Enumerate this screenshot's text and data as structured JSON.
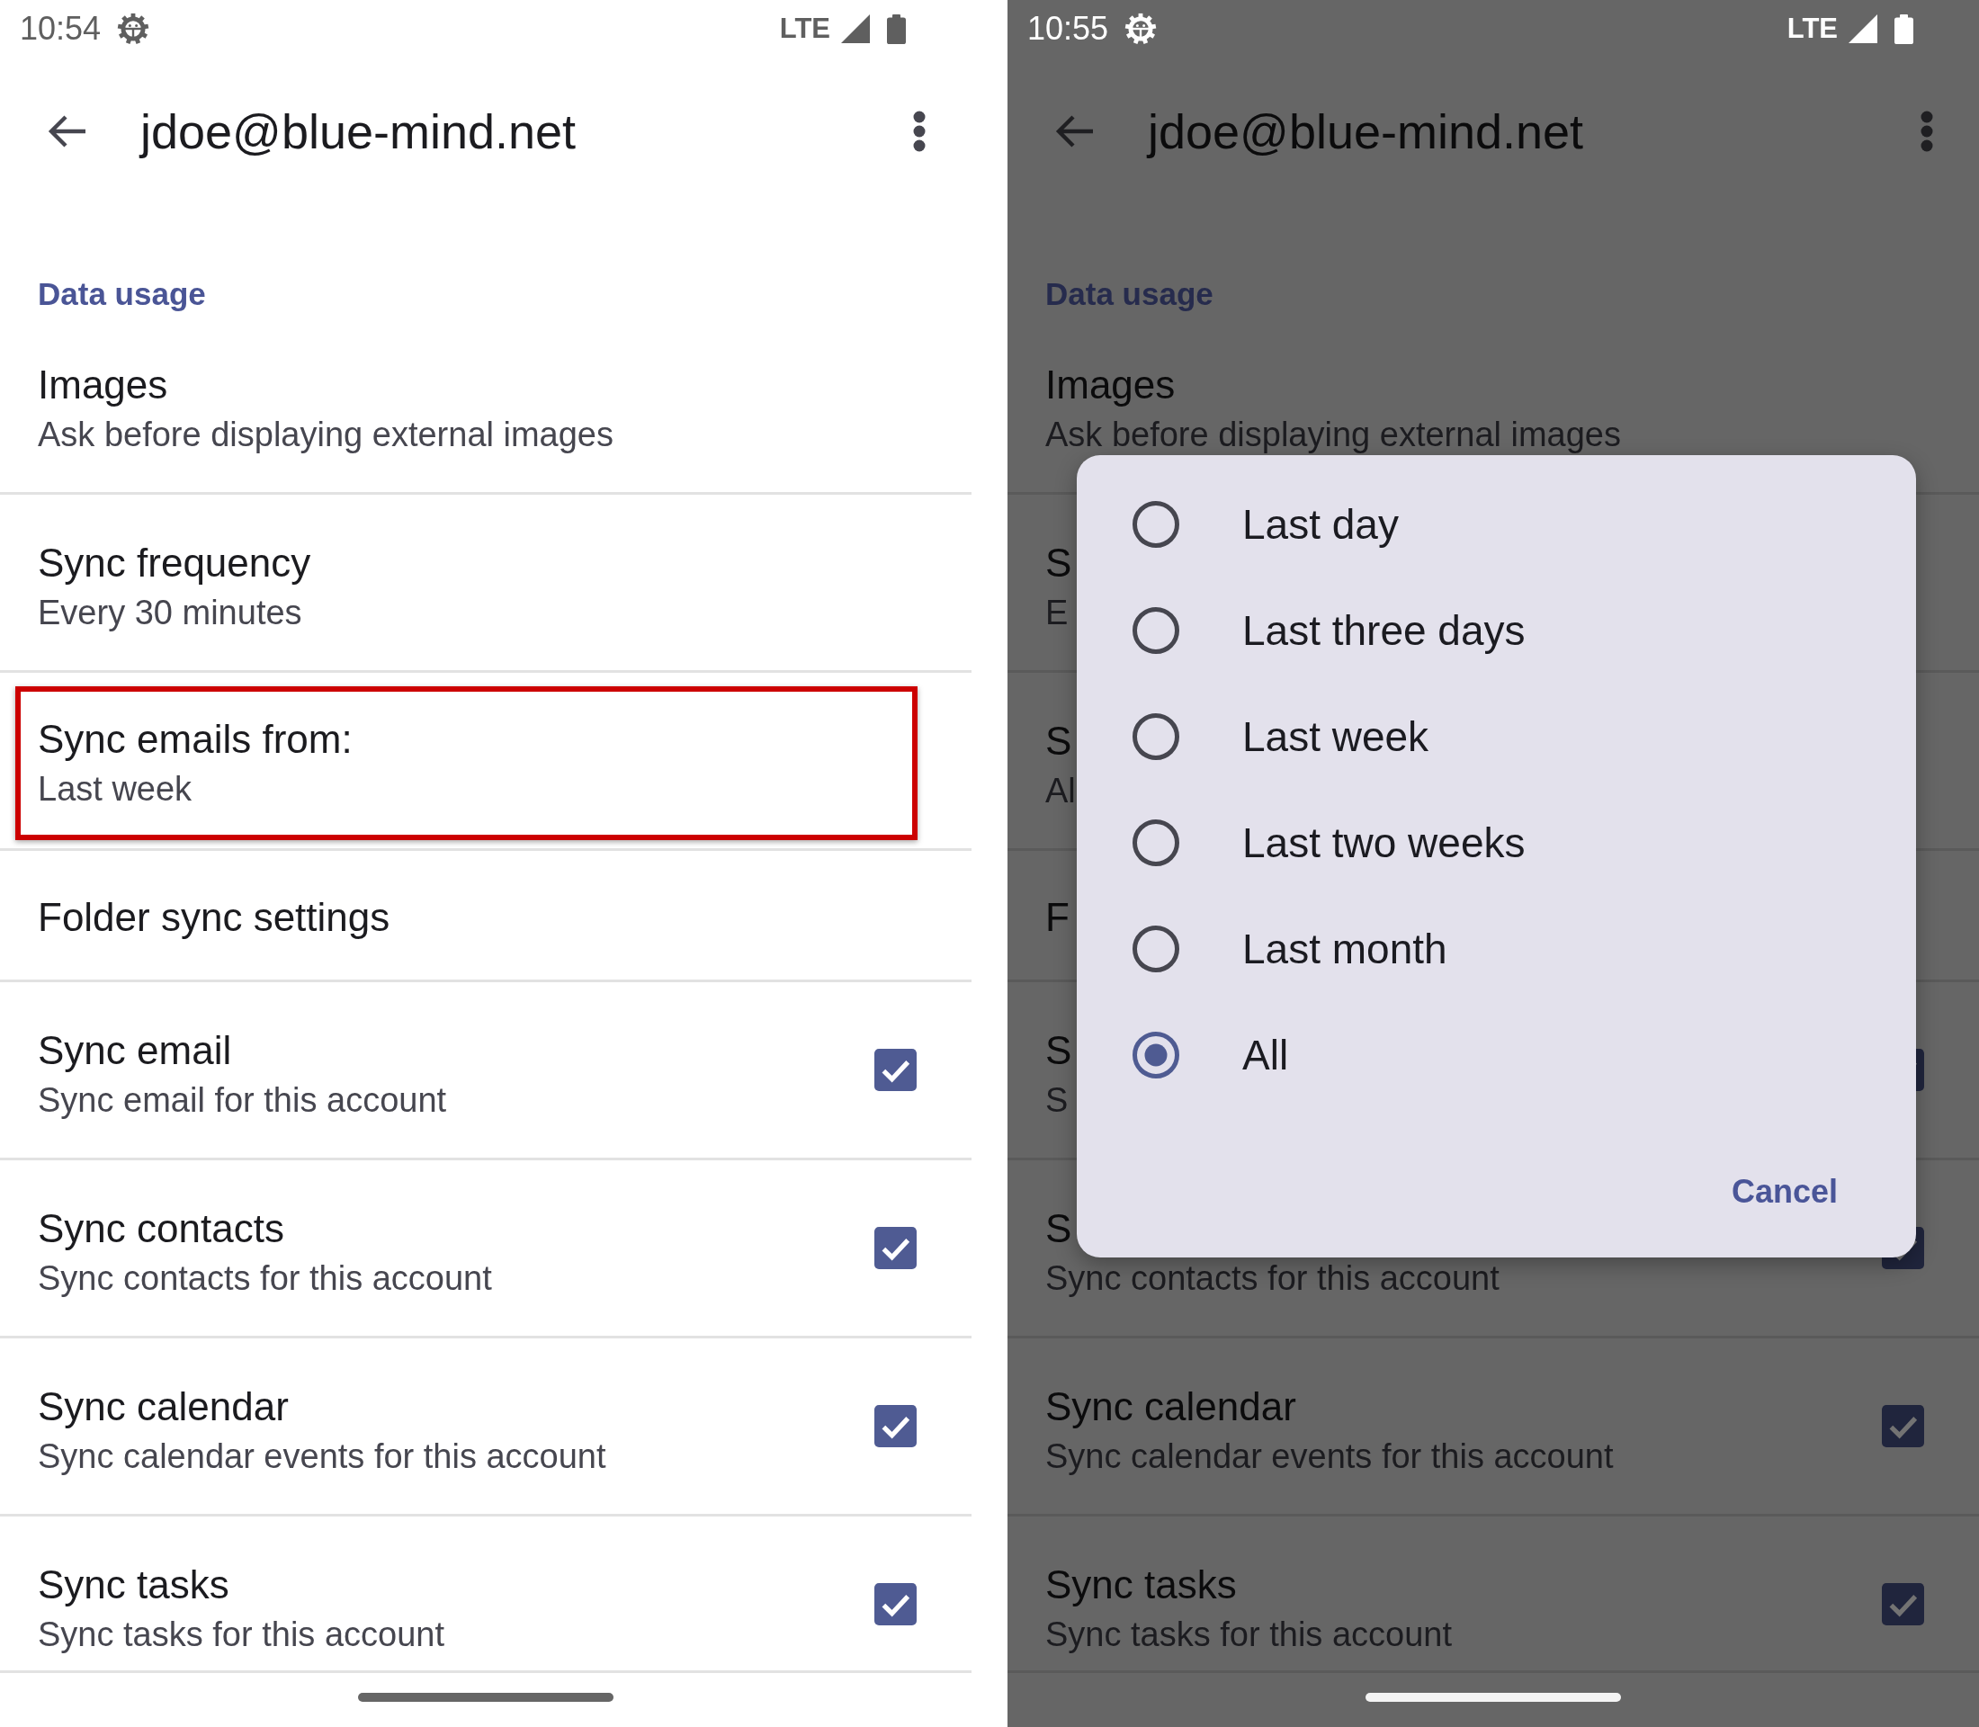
{
  "screens": [
    {
      "status_bar": {
        "time": "10:54",
        "network": "LTE"
      },
      "app_bar": {
        "title": "jdoe@blue-mind.net"
      },
      "section_header": "Data usage",
      "settings": [
        {
          "kind": "text",
          "title": "Images",
          "summary": "Ask before displaying external images",
          "highlighted": false
        },
        {
          "kind": "text",
          "title": "Sync frequency",
          "summary": "Every 30 minutes",
          "highlighted": false
        },
        {
          "kind": "text",
          "title": "Sync emails from:",
          "summary": "Last week",
          "highlighted": true
        },
        {
          "kind": "text",
          "title": "Folder sync settings",
          "highlighted": false
        },
        {
          "kind": "checkbox",
          "title": "Sync email",
          "summary": "Sync email for this account",
          "highlighted": false,
          "checked": true
        },
        {
          "kind": "checkbox",
          "title": "Sync contacts",
          "summary": "Sync contacts for this account",
          "highlighted": false,
          "checked": true
        },
        {
          "kind": "checkbox",
          "title": "Sync calendar",
          "summary": "Sync calendar events for this account",
          "highlighted": false,
          "checked": true
        },
        {
          "kind": "checkbox",
          "title": "Sync tasks",
          "summary": "Sync tasks for this account",
          "highlighted": false,
          "checked": true
        }
      ]
    },
    {
      "status_bar": {
        "time": "10:55",
        "network": "LTE"
      },
      "app_bar": {
        "title": "jdoe@blue-mind.net"
      },
      "section_header": "Data usage",
      "settings": [
        {
          "kind": "text",
          "title": "Images",
          "summary": "Ask before displaying external images"
        },
        {
          "kind": "text",
          "title": "S",
          "summary": "E"
        },
        {
          "kind": "text",
          "title": "S",
          "summary": "Al"
        },
        {
          "kind": "text",
          "title": "F"
        },
        {
          "kind": "checkbox",
          "title": "S",
          "summary": "S",
          "checked": true
        },
        {
          "kind": "checkbox",
          "title": "S",
          "summary": "Sync contacts for this account",
          "checked": true
        },
        {
          "kind": "checkbox",
          "title": "Sync calendar",
          "summary": "Sync calendar events for this account",
          "checked": true
        },
        {
          "kind": "checkbox",
          "title": "Sync tasks",
          "summary": "Sync tasks for this account",
          "checked": true
        }
      ],
      "dialog": {
        "options": [
          {
            "label": "Last day",
            "selected": false
          },
          {
            "label": "Last three days",
            "selected": false
          },
          {
            "label": "Last week",
            "selected": false
          },
          {
            "label": "Last two weeks",
            "selected": false
          },
          {
            "label": "Last month",
            "selected": false
          },
          {
            "label": "All",
            "selected": true
          }
        ],
        "cancel": "Cancel"
      }
    }
  ]
}
